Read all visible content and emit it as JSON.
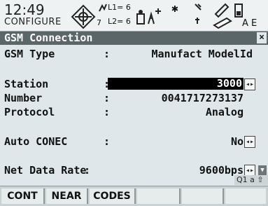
{
  "status": {
    "time": "12:49",
    "profile": "CONFIGURE",
    "sat_count": "7",
    "l1": "L1= 6",
    "l2": "L2= 6",
    "page_letter": "A E"
  },
  "title": "GSM Connection",
  "close_glyph": "×",
  "fields": [
    {
      "label": "GSM Type",
      "value": "Manufact ModelId"
    },
    {
      "label": "Station",
      "value": "3000"
    },
    {
      "label": "Number",
      "value": "0041717273137"
    },
    {
      "label": "Protocol",
      "value": "Analog"
    },
    {
      "label": "Auto CONEC",
      "value": "No"
    },
    {
      "label": "Net Data Rate",
      "value": "9600bps"
    }
  ],
  "colon": ":",
  "input_mode": "Q1 a ⇧",
  "fkeys": [
    "CONT",
    "NEAR",
    "CODES",
    "",
    "",
    ""
  ],
  "colors": {
    "accent_bar": "#5a6668",
    "background": "#dfe7ea"
  }
}
